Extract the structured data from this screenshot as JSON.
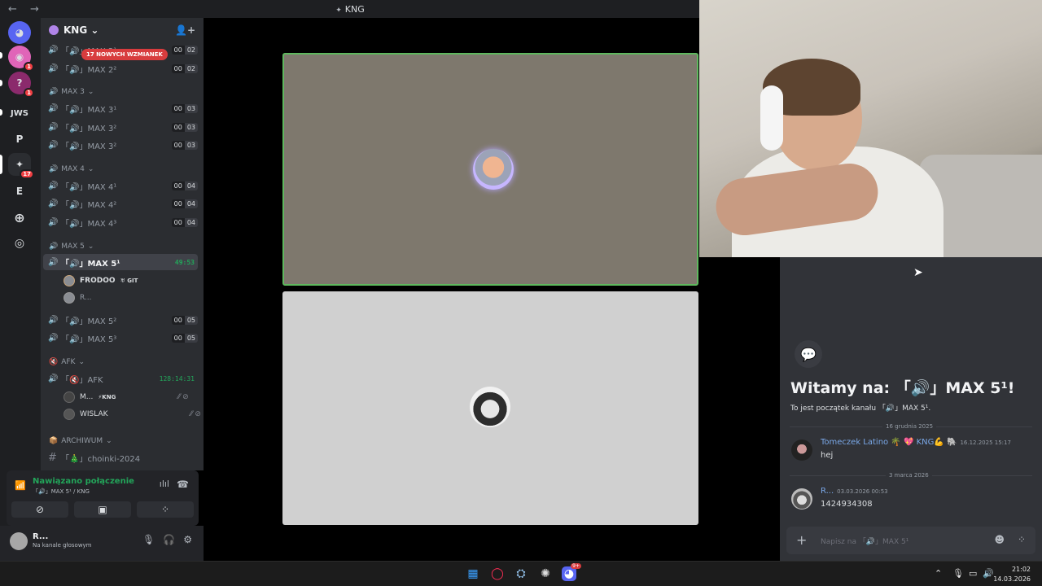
{
  "window": {
    "title": "KNG",
    "nav": "← →"
  },
  "guilds": [
    {
      "label": "discord-home",
      "glyph": "◕"
    },
    {
      "label": "dm",
      "glyph": "◉",
      "badge": "1"
    },
    {
      "label": "server-question",
      "glyph": "?",
      "badge": "1"
    },
    {
      "label": "JWS",
      "glyph": "JWS"
    },
    {
      "label": "P",
      "glyph": "P"
    },
    {
      "label": "KNG",
      "glyph": "✦",
      "badge": "17"
    },
    {
      "label": "E",
      "glyph": "E"
    },
    {
      "label": "add-server",
      "glyph": "+"
    },
    {
      "label": "explore",
      "glyph": "◎"
    }
  ],
  "server": {
    "name": "KNG",
    "caret": "⌄"
  },
  "mention_banner": "17 NOWYCH WZMIANEK",
  "channels": [
    {
      "name": "「🔊」MAX 2²",
      "count": [
        "00",
        "02"
      ]
    },
    {
      "category": "MAX 3"
    },
    {
      "name": "「🔊」MAX 3¹",
      "count": [
        "00",
        "03"
      ]
    },
    {
      "name": "「🔊」MAX 3²",
      "count": [
        "00",
        "03"
      ]
    },
    {
      "name": "「🔊」MAX 3²",
      "count": [
        "00",
        "03"
      ]
    },
    {
      "category": "MAX 4"
    },
    {
      "name": "「🔊」MAX 4¹",
      "count": [
        "00",
        "04"
      ]
    },
    {
      "name": "「🔊」MAX 4²",
      "count": [
        "00",
        "04"
      ]
    },
    {
      "name": "「🔊」MAX 4³",
      "count": [
        "00",
        "04"
      ]
    },
    {
      "category": "MAX 5"
    },
    {
      "name": "「🔊」MAX 5¹",
      "timer": "49:53",
      "active": true
    },
    {
      "name": "「🔊」MAX 5²",
      "count": [
        "00",
        "05"
      ]
    },
    {
      "name": "「🔊」MAX 5³",
      "count": [
        "00",
        "05"
      ]
    },
    {
      "category": "AFK"
    },
    {
      "name": "「🔇」AFK",
      "timer": "128:14:31"
    },
    {
      "category": "ARCHIWUM"
    },
    {
      "name": "「🎄」choinki-2024"
    }
  ],
  "voice_users_max5": [
    {
      "name": "FRODOO",
      "tag": "GIT"
    },
    {
      "name": "R..."
    }
  ],
  "voice_users_afk": [
    {
      "name": "M...",
      "tag": "KNG"
    },
    {
      "name": "WISLAK"
    }
  ],
  "voice_panel": {
    "status": "Nawiązano połączenie",
    "channel": "「🔊」MAX 5¹ / KNG",
    "buttons": [
      "camera-off",
      "screen-share",
      "activities"
    ]
  },
  "user_panel": {
    "name": "R...",
    "status": "Na kanale głosowym"
  },
  "chat": {
    "welcome_title": "Witamy na: 「🔊」MAX 5¹!",
    "welcome_sub": "To jest początek kanału 「🔊」MAX 5¹.",
    "dividers": [
      "16 grudnia 2025",
      "3 marca 2026"
    ],
    "messages": [
      {
        "author": "Tomeczek Latino 🌴 💖 KNG💪 🐘",
        "time": "16.12.2025 15:17",
        "text": "hej"
      },
      {
        "author": "R...",
        "time": "03.03.2026 00:53",
        "text": "1424934308"
      }
    ],
    "placeholder": "Napisz na 「🔊」MAX 5¹"
  },
  "taskbar": {
    "apps": [
      "windows-start",
      "opera",
      "steam",
      "chatgpt",
      "discord"
    ],
    "discord_badge": "9+",
    "time": "21:02",
    "date": "14.03.2026"
  },
  "colors": {
    "accent_green": "#23a55a",
    "mention_red": "#d83c3e",
    "link_blue": "#7aa8e8"
  }
}
